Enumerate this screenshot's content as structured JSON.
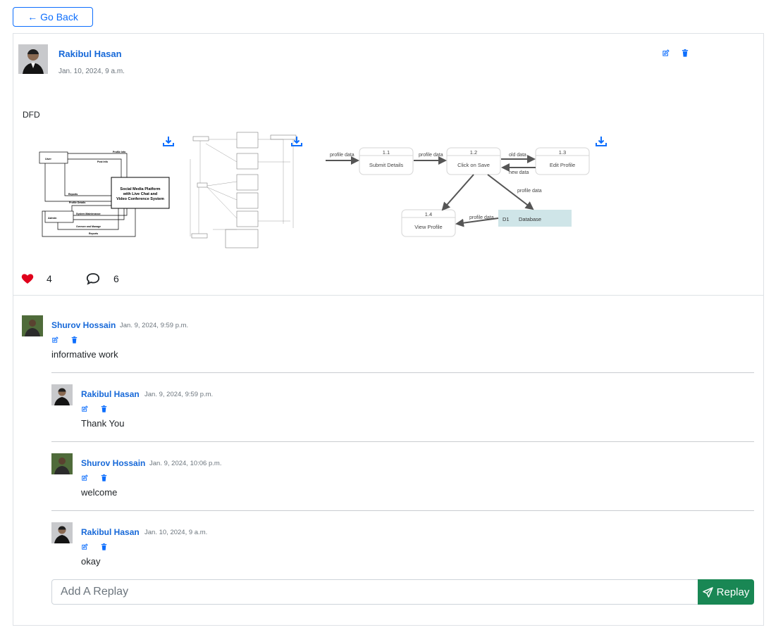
{
  "back_button": {
    "label": "Go Back"
  },
  "post": {
    "author": "Rakibul Hasan",
    "date": "Jan. 10, 2024, 9 a.m.",
    "body": "DFD",
    "like_count": "4",
    "comment_count": "6"
  },
  "diagram1": {
    "center": [
      "Social Media Platform",
      "with Live Chat and",
      "Video Conference System"
    ],
    "user": "User",
    "admin": "Admin",
    "profile_info": "Profile Info",
    "post_info": "Post Info",
    "reports": "Reports",
    "profile_details": "Profile Details",
    "system_maintenance": "System Maintenance",
    "oversee_manage": "Oversee and Manage",
    "reports2": "Reports"
  },
  "diagram3": {
    "p1_id": "1.1",
    "p1": "Submit Details",
    "p2_id": "1.2",
    "p2": "Click on Save",
    "p3_id": "1.3",
    "p3": "Edit Profile",
    "p4_id": "1.4",
    "p4": "View Profile",
    "store_id": "D1",
    "store": "Database",
    "f1": "profile data",
    "f2": "profile data",
    "f3": "old data",
    "f4": "new data",
    "f5": "profile data",
    "f6": "profile data"
  },
  "comments": [
    {
      "author": "Shurov Hossain",
      "date": "Jan. 9, 2024, 9:59 p.m.",
      "text": "informative work"
    },
    {
      "author": "Rakibul Hasan",
      "date": "Jan. 9, 2024, 9:59 p.m.",
      "text": "Thank You"
    },
    {
      "author": "Shurov Hossain",
      "date": "Jan. 9, 2024, 10:06 p.m.",
      "text": "welcome"
    },
    {
      "author": "Rakibul Hasan",
      "date": "Jan. 10, 2024, 9 a.m.",
      "text": "okay"
    }
  ],
  "reply": {
    "placeholder": "Add A Replay",
    "button_label": "Replay"
  },
  "colors": {
    "primary": "#0d6efd",
    "success": "#198754",
    "heart": "#e0001b",
    "name": "#1668d8"
  }
}
